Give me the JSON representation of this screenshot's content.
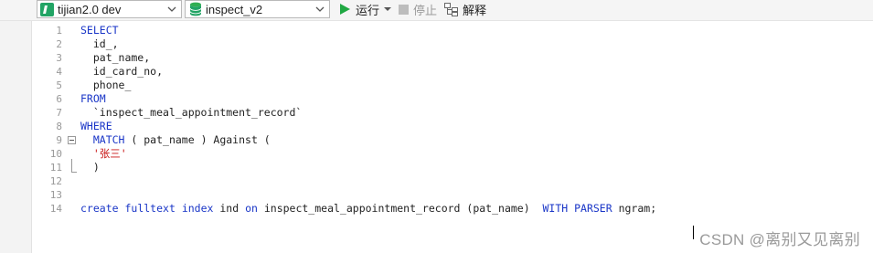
{
  "toolbar": {
    "connection": "tijian2.0 dev",
    "database": "inspect_v2",
    "run_label": "运行",
    "stop_label": "停止",
    "explain_label": "解释"
  },
  "editor": {
    "lines": [
      {
        "n": "1",
        "segs": [
          {
            "t": "SELECT",
            "c": "kw"
          }
        ]
      },
      {
        "n": "2",
        "segs": [
          {
            "t": "  id_,",
            "c": ""
          }
        ]
      },
      {
        "n": "3",
        "segs": [
          {
            "t": "  pat_name,",
            "c": ""
          }
        ]
      },
      {
        "n": "4",
        "segs": [
          {
            "t": "  id_card_no,",
            "c": ""
          }
        ]
      },
      {
        "n": "5",
        "segs": [
          {
            "t": "  phone_",
            "c": ""
          }
        ]
      },
      {
        "n": "6",
        "segs": [
          {
            "t": "FROM",
            "c": "kw"
          }
        ]
      },
      {
        "n": "7",
        "segs": [
          {
            "t": "  `inspect_meal_appointment_record`",
            "c": ""
          }
        ]
      },
      {
        "n": "8",
        "segs": [
          {
            "t": "WHERE",
            "c": "kw"
          }
        ]
      },
      {
        "n": "9",
        "segs": [
          {
            "t": "  ",
            "c": ""
          },
          {
            "t": "MATCH",
            "c": "kw"
          },
          {
            "t": " ( pat_name ) Against (",
            "c": ""
          }
        ]
      },
      {
        "n": "10",
        "segs": [
          {
            "t": "  ",
            "c": ""
          },
          {
            "t": "'张三'",
            "c": "str"
          }
        ]
      },
      {
        "n": "11",
        "segs": [
          {
            "t": "  )",
            "c": ""
          }
        ]
      },
      {
        "n": "12",
        "segs": []
      },
      {
        "n": "13",
        "segs": []
      },
      {
        "n": "14",
        "segs": [
          {
            "t": "create",
            "c": "kw"
          },
          {
            "t": " ",
            "c": ""
          },
          {
            "t": "fulltext",
            "c": "kw"
          },
          {
            "t": " ",
            "c": ""
          },
          {
            "t": "index",
            "c": "kw"
          },
          {
            "t": " ind ",
            "c": ""
          },
          {
            "t": "on",
            "c": "kw"
          },
          {
            "t": " inspect_meal_appointment_record (pat_name)  ",
            "c": ""
          },
          {
            "t": "WITH PARSER",
            "c": "kw"
          },
          {
            "t": " ngram;",
            "c": ""
          }
        ]
      }
    ]
  },
  "watermark": "CSDN @离别又见离别",
  "colors": {
    "keyword": "#1a36c7",
    "string": "#c81414",
    "run_green": "#21a464"
  },
  "icons": [
    "connection-icon",
    "database-icon",
    "chevron-down-icon",
    "play-icon",
    "dropdown-arrow-icon",
    "stop-icon",
    "explain-icon",
    "fold-toggle-icon"
  ]
}
